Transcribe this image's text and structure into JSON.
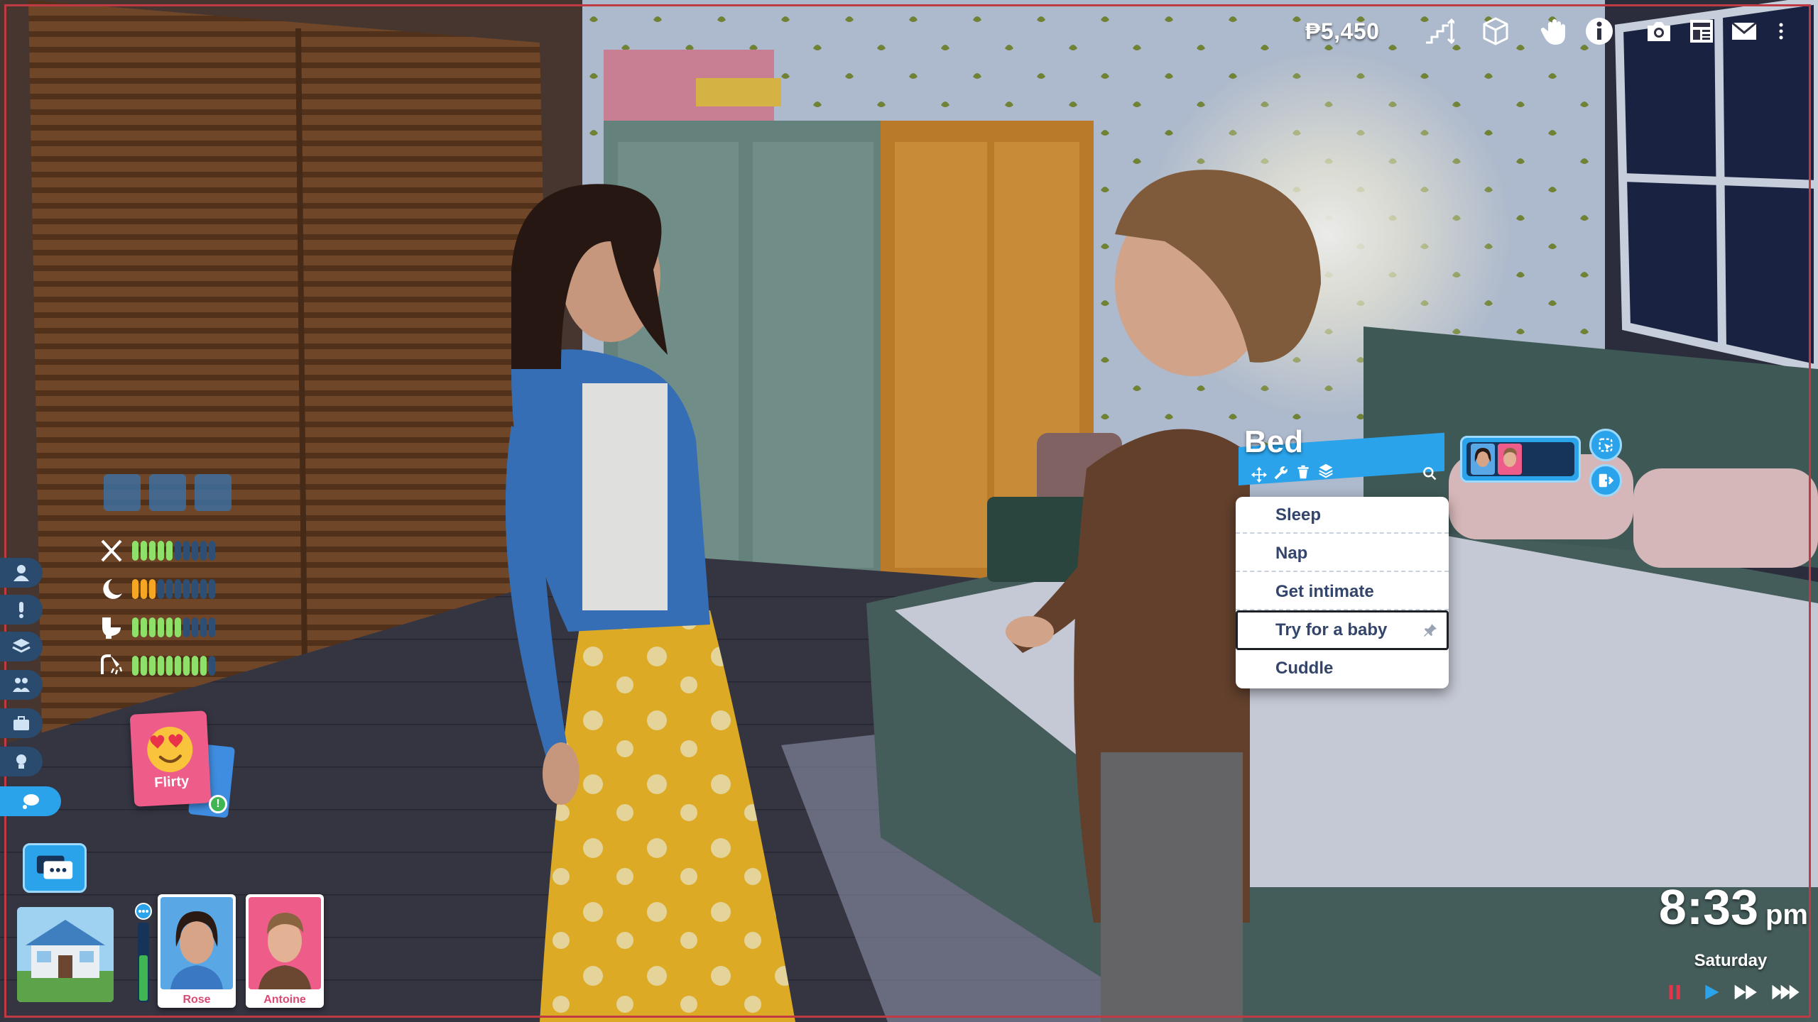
{
  "hud": {
    "money": "₱5,450",
    "top_icons": [
      "stairs-level-icon",
      "build-cube-icon",
      "hand-pointer-icon",
      "info-icon",
      "camera-icon",
      "newspaper-icon",
      "mail-icon",
      "more-vertical-icon"
    ]
  },
  "left_rail": {
    "buttons": [
      "person-icon",
      "alert-icon",
      "layers-icon",
      "family-icon",
      "briefcase-icon",
      "lightbulb-icon",
      "thought-bubble-icon"
    ],
    "active": "thought-bubble-icon"
  },
  "needs": [
    {
      "icon": "fork-knife-icon",
      "level": 0.5,
      "color": "#8ee06a"
    },
    {
      "icon": "sleep-moon-icon",
      "level": 0.3,
      "color": "#f5a623"
    },
    {
      "icon": "toilet-icon",
      "level": 0.6,
      "color": "#8ee06a"
    },
    {
      "icon": "shower-icon",
      "level": 0.9,
      "color": "#8ee06a"
    }
  ],
  "mood": {
    "label": "Flirty"
  },
  "household": {
    "sims": [
      {
        "name": "Rose"
      },
      {
        "name": "Antoine"
      }
    ]
  },
  "object_menu": {
    "title": "Bed",
    "tools": [
      "move-icon",
      "wrench-icon",
      "trash-icon",
      "layers-icon"
    ],
    "search_icon": "search-icon",
    "items": [
      "Sleep",
      "Nap",
      "Get intimate",
      "Try for a baby",
      "Cuddle"
    ],
    "selected_index": 3,
    "pinned_index": 3
  },
  "clock": {
    "time": "8:33",
    "ampm": "pm",
    "day": "Saturday"
  },
  "speed_controls": [
    "pause-icon",
    "play-icon",
    "fast-forward-icon",
    "ultra-speed-icon"
  ],
  "colors": {
    "accent": "#2aa3ea",
    "pause": "#e8334a",
    "menu_text": "#33456a",
    "need_green": "#8ee06a",
    "need_orange": "#f5a623"
  }
}
